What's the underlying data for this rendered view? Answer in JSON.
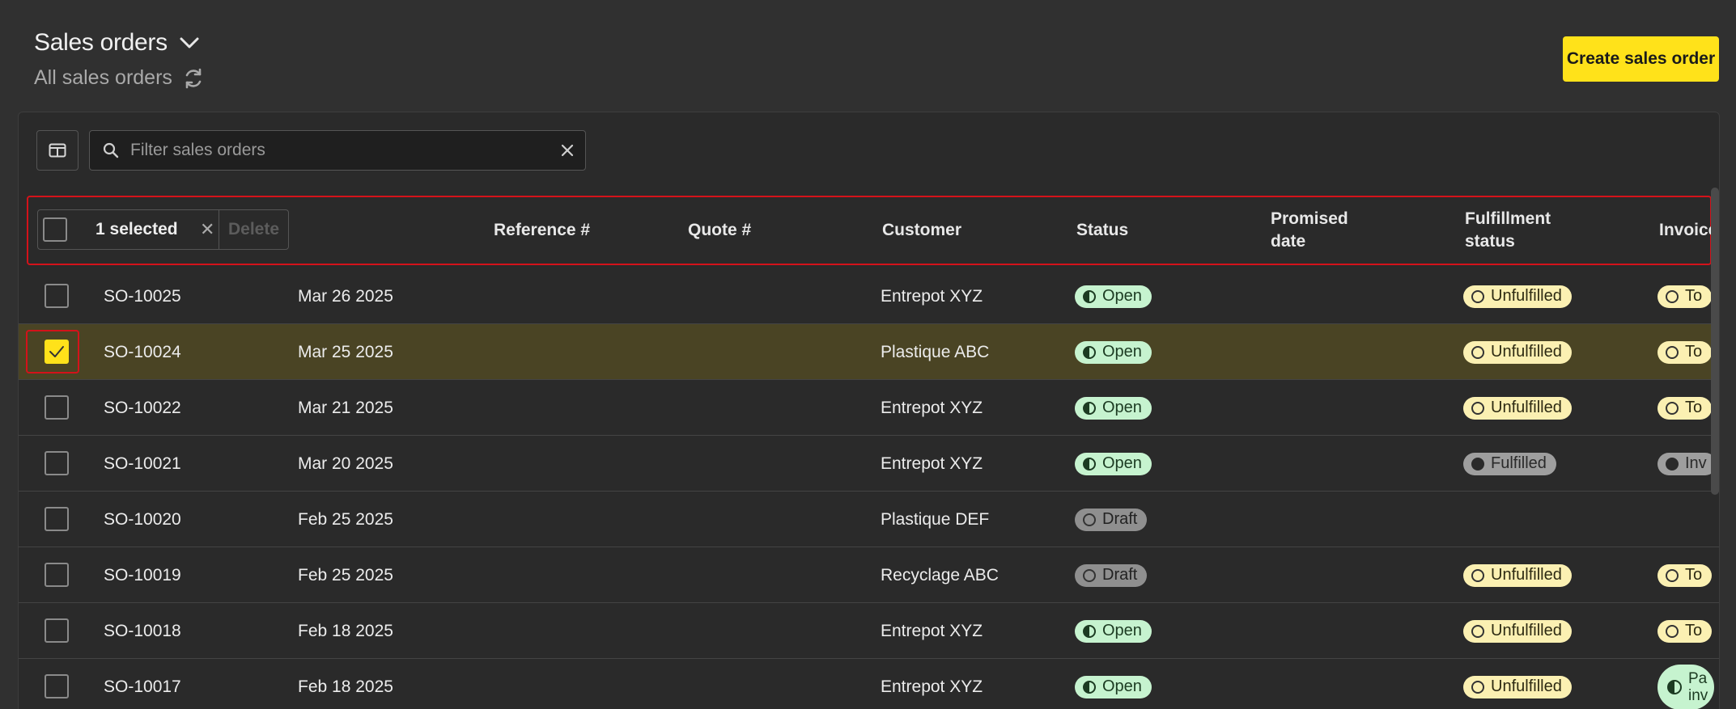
{
  "header": {
    "title": "Sales orders",
    "subtitle": "All sales orders",
    "create_label": "Create sales order"
  },
  "toolbar": {
    "search_placeholder": "Filter sales orders"
  },
  "selection": {
    "label": "1 selected",
    "delete_label": "Delete"
  },
  "columns": {
    "reference": "Reference #",
    "quote": "Quote #",
    "customer": "Customer",
    "status": "Status",
    "promised_line1": "Promised",
    "promised_line2": "date",
    "fulfillment_line1": "Fulfillment",
    "fulfillment_line2": "status",
    "invoice": "Invoice"
  },
  "rows": [
    {
      "id": "SO-10025",
      "date": "Mar 26 2025",
      "customer": "Entrepot XYZ",
      "status": "Open",
      "fulfillment": "Unfulfilled",
      "invoice": "To",
      "selected": false
    },
    {
      "id": "SO-10024",
      "date": "Mar 25 2025",
      "customer": "Plastique ABC",
      "status": "Open",
      "fulfillment": "Unfulfilled",
      "invoice": "To",
      "selected": true
    },
    {
      "id": "SO-10022",
      "date": "Mar 21 2025",
      "customer": "Entrepot XYZ",
      "status": "Open",
      "fulfillment": "Unfulfilled",
      "invoice": "To",
      "selected": false
    },
    {
      "id": "SO-10021",
      "date": "Mar 20 2025",
      "customer": "Entrepot XYZ",
      "status": "Open",
      "fulfillment": "Fulfilled",
      "invoice": "Inv",
      "selected": false
    },
    {
      "id": "SO-10020",
      "date": "Feb 25 2025",
      "customer": "Plastique DEF",
      "status": "Draft",
      "fulfillment": "",
      "invoice": "",
      "selected": false
    },
    {
      "id": "SO-10019",
      "date": "Feb 25 2025",
      "customer": "Recyclage ABC",
      "status": "Draft",
      "fulfillment": "Unfulfilled",
      "invoice": "To",
      "selected": false
    },
    {
      "id": "SO-10018",
      "date": "Feb 18 2025",
      "customer": "Entrepot XYZ",
      "status": "Open",
      "fulfillment": "Unfulfilled",
      "invoice": "To",
      "selected": false
    },
    {
      "id": "SO-10017",
      "date": "Feb 18 2025",
      "customer": "Entrepot XYZ",
      "status": "Open",
      "fulfillment": "Unfulfilled",
      "invoice_line1": "Pa",
      "invoice_line2": "inv",
      "selected": false
    }
  ],
  "colors": {
    "accent": "#ffe21a",
    "selected_row": "#4a4424",
    "highlight_outline": "#d4121a"
  },
  "icons": [
    "chevron-down-icon",
    "refresh-icon",
    "columns-icon",
    "search-icon",
    "close-icon",
    "check-icon"
  ]
}
